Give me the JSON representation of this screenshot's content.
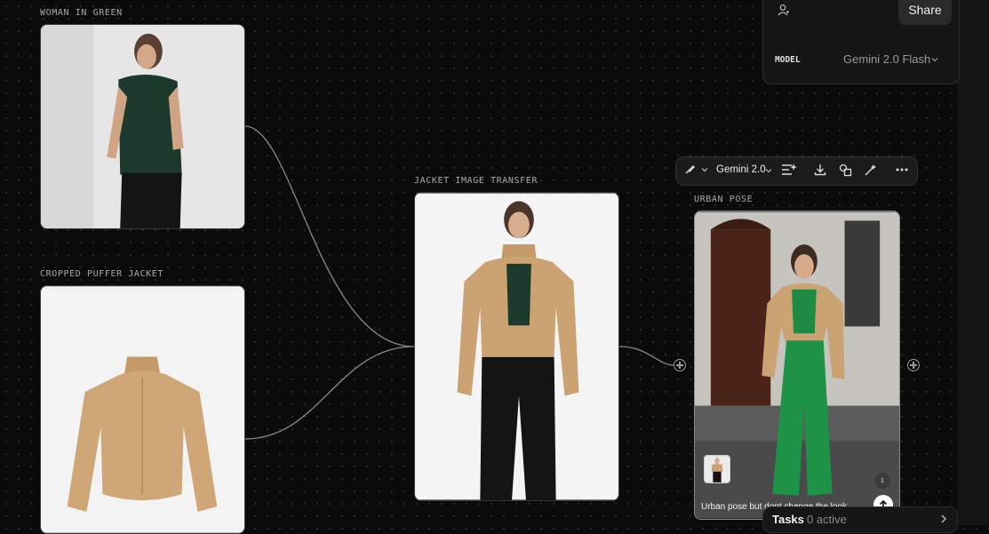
{
  "nodes": {
    "woman": {
      "label": "WOMAN IN GREEN"
    },
    "jacket": {
      "label": "CROPPED PUFFER JACKET"
    },
    "transfer": {
      "label": "JACKET IMAGE TRANSFER"
    },
    "urban": {
      "label": "URBAN POSE"
    }
  },
  "panel": {
    "share_label": "Share",
    "model_label": "MODEL",
    "model_value": "Gemini 2.0 Flash"
  },
  "toolbar": {
    "model_label": "Gemini 2.0"
  },
  "urban_card": {
    "prompt": "Urban pose but dont change the look",
    "count_badge": "1"
  },
  "tasks": {
    "title": "Tasks",
    "count": "0 active"
  },
  "icons": {
    "person": "user-plus-icon",
    "brush": "brush-icon",
    "sparkle": "sparkle-adjust-icon",
    "download": "download-icon",
    "shapes": "shapes-icon",
    "wand": "magic-wand-icon",
    "more": "more-icon",
    "send": "arrow-up-icon"
  }
}
